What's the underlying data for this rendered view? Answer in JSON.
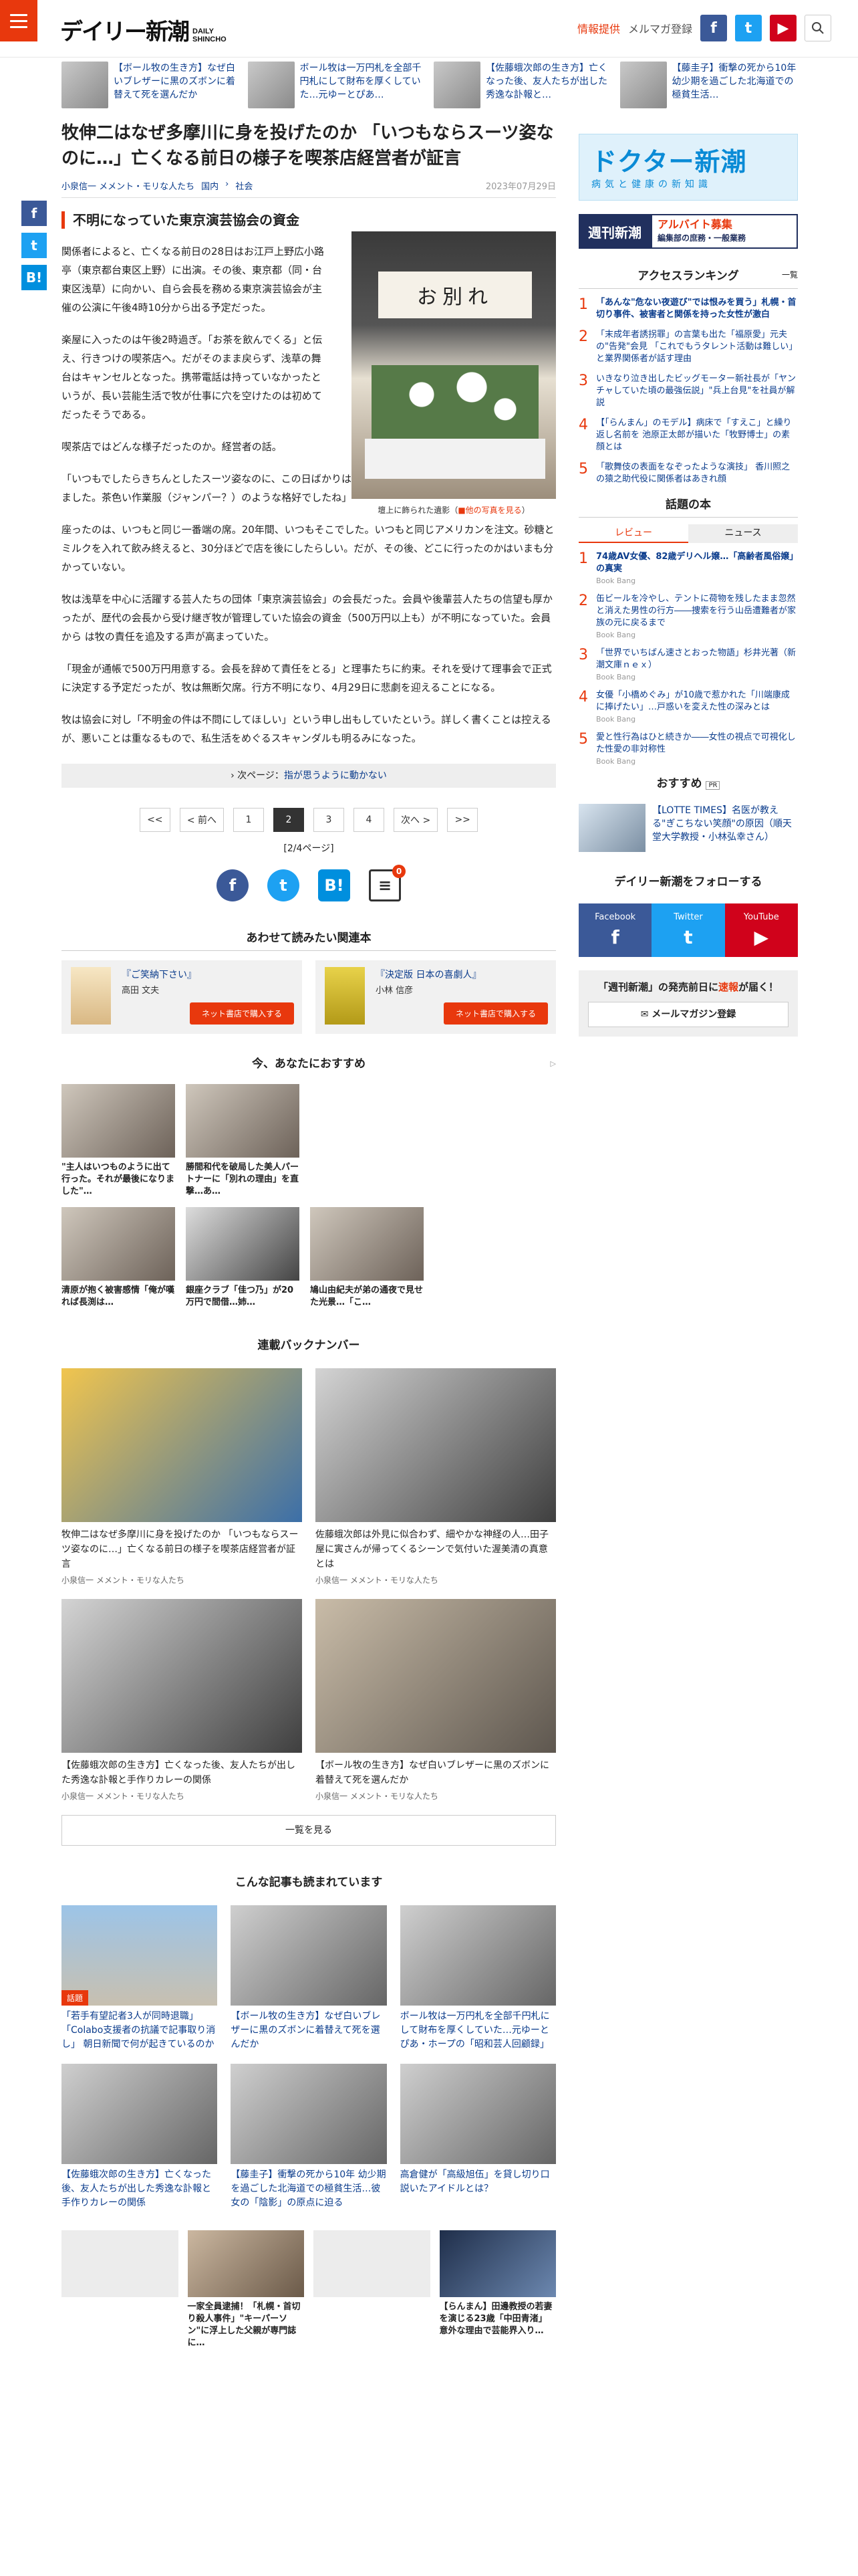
{
  "header": {
    "logo_jp": "デイリー新潮",
    "logo_en_1": "DAILY",
    "logo_en_2": "SHINCHO",
    "info_link": "情報提供",
    "mailmag_link": "メルマガ登録",
    "fb": "f",
    "tw": "t",
    "yt": "▶"
  },
  "strip": [
    {
      "text": "【ボール牧の生き方】なぜ白いブレザーに黒のズボンに着替えて死を選んだか"
    },
    {
      "text": "ボール牧は一万円札を全部千円札にして財布を厚くしていた…元ゆーとぴあ…"
    },
    {
      "text": "【佐藤蛾次郎の生き方】亡くなった後、友人たちが出した秀逸な訃報と…"
    },
    {
      "text": "【藤圭子】衝撃の死から10年 幼少期を過ごした北海道での極貧生活…"
    }
  ],
  "article": {
    "headline": "牧伸二はなぜ多摩川に身を投げたのか 「いつもならスーツ姿なのに…」亡くなる前日の様子を喫茶店経営者が証言",
    "author": "小泉信一 メメント・モリな人たち",
    "cat1": "国内",
    "cat2": "社会",
    "date": "2023年07月29日",
    "section": "不明になっていた東京演芸協会の資金",
    "p1": "関係者によると、亡くなる前日の28日はお江戸上野広小路亭（東京都台東区上野）に出演。その後、東京都（同・台東区浅草）に向かい、自ら会長を務める東京演芸協会が主催の公演に午後4時10分から出る予定だった。",
    "p2": "楽屋に入ったのは午後2時過ぎ。「お茶を飲んでくる」と伝え、行きつけの喫茶店へ。だがそのまま戻らず、浅草の舞台はキャンセルとなった。携帯電話は持っていなかったというが、長い芸能生活で牧が仕事に穴を空けたのは初めてだったそうである。",
    "p3": "喫茶店ではどんな様子だったのか。経営者の話。",
    "p4": "「いつもでしたらきちんとしたスーツ姿なのに、この日ばかりは浮かない顔つきで一人でコーヒーを飲んでいました。茶色い作業服（ジャンパー？）のような格好でしたね」",
    "p5": "座ったのは、いつもと同じ一番端の席。20年間、いつもそこでした。いつもと同じアメリカンを注文。砂糖とミルクを入れて飲み終えると、30分ほどで店を後にしたらしい。だが、その後、どこに行ったのかはいまも分かっていない。",
    "p6": "牧は浅草を中心に活躍する芸人たちの団体「東京演芸協会」の会長だった。会員や後輩芸人たちの信望も厚かったが、歴代の会長から受け継ぎ牧が管理していた協会の資金（500万円以上も）が不明になっていた。会員から は牧の責任を追及する声が高まっていた。",
    "p7": "「現金が通帳で500万円用意する。会長を辞めて責任をとる」と理事たちに約束。それを受けて理事会で正式に決定する予定だったが、牧は無断欠席。行方不明になり、4月29日に悲劇を迎えることになる。",
    "p8": "牧は協会に対し「不明金の件は不問にしてほしい」という申し出もしていたという。詳しく書くことは控えるが、悪いことは重なるもので、私生活をめぐるスキャンダルも明るみになった。",
    "photo_banner": "お別れ",
    "photo_caption": "壇上に飾られた遺影",
    "photo_caption_link": "他の写真を見る",
    "next_label": "次ページ：",
    "next_link": "指が思うように動かない",
    "pager": [
      "<<",
      "< 前へ",
      "1",
      "2",
      "3",
      "4",
      "次へ >",
      ">>"
    ],
    "page_count": "[2/4ページ]",
    "comment_count": "0"
  },
  "related": {
    "head": "あわせて読みたい関連本",
    "books": [
      {
        "title": "『ご笑納下さい』",
        "author": "高田 文夫",
        "buy": "ネット書店で購入する"
      },
      {
        "title": "『決定版 日本の喜劇人』",
        "author": "小林 信彦",
        "buy": "ネット書店で購入する"
      }
    ]
  },
  "recommend": {
    "head": "今、あなたにおすすめ",
    "items": [
      {
        "text": "\"主人はいつものように出て行った。それが最後になりました\"…"
      },
      {
        "text": "勝間和代を破局した美人パートナーに「別れの理由」を直撃…あ…"
      },
      {
        "text": ""
      },
      {
        "text": "清原が抱く被害感情「俺が嘆れば長渕は…"
      },
      {
        "text": "銀座クラブ「佳つ乃」が20万円で間借…姉…"
      },
      {
        "text": "鳩山由紀夫が弟の通夜で見せた光景…「こ…"
      }
    ]
  },
  "backnumbers": {
    "head": "連載バックナンバー",
    "items": [
      {
        "title": "牧伸二はなぜ多摩川に身を投げたのか 「いつもならスーツ姿なのに…」亡くなる前日の様子を喫茶店経営者が証言",
        "author": "小泉信一 メメント・モリな人たち"
      },
      {
        "title": "佐藤蛾次郎は外見に似合わず、細やかな神経の人…田子屋に寅さんが帰ってくるシーンで気付いた渥美清の真意とは",
        "author": "小泉信一 メメント・モリな人たち"
      },
      {
        "title": "【佐藤蛾次郎の生き方】亡くなった後、友人たちが出した秀逸な訃報と手作りカレーの関係",
        "author": "小泉信一 メメント・モリな人たち"
      },
      {
        "title": "【ボール牧の生き方】なぜ白いブレザーに黒のズボンに着替えて死を選んだか",
        "author": "小泉信一 メメント・モリな人たち"
      }
    ],
    "see_all": "一覧を見る"
  },
  "also_read": {
    "head": "こんな記事も読まれています",
    "items": [
      {
        "tag": "話題",
        "text": "「若手有望記者3人が同時退職」「Colabo支援者の抗議で記事取り消し」 朝日新聞で何が起きているのか"
      },
      {
        "tag": "",
        "text": "【ボール牧の生き方】なぜ白いブレザーに黒のズボンに着替えて死を選んだか"
      },
      {
        "tag": "",
        "text": "ボール牧は一万円札を全部千円札にして財布を厚くしていた…元ゆーとぴあ・ホープの「昭和芸人回顧録」"
      },
      {
        "tag": "",
        "text": "【佐藤蛾次郎の生き方】亡くなった後、友人たちが出した秀逸な訃報と手作りカレーの関係"
      },
      {
        "tag": "",
        "text": "【藤圭子】衝撃の死から10年 幼少期を過ごした北海道での極貧生活…彼女の「陰影」の原点に迫る"
      },
      {
        "tag": "",
        "text": "高倉健が「高級旭伍」を貸し切り口説いたアイドルとは？"
      }
    ]
  },
  "more_ads": [
    {
      "text": ""
    },
    {
      "text": "一家全員逮捕！「札幌・首切り殺人事件」\"キーパーソン\"に浮上した父親が専門誌に…"
    },
    {
      "text": ""
    },
    {
      "text": "【らんまん】田邊教授の若妻を演じる23歳「中田青渚」 意外な理由で芸能界入り…"
    }
  ],
  "sidebar": {
    "doctor_a": "ドクター新潮",
    "doctor_b": "病気と健康の新知識",
    "shukan_l": "週刊新潮",
    "shukan_r": "アルバイト募集",
    "shukan_r2": "編集部の庶務・一般業務",
    "ranking_head": "アクセスランキング",
    "ranking_sub": "一覧",
    "ranking": [
      {
        "n": "1",
        "t": "「あんな\"危ない夜遊び\"では恨みを買う」札幌・首切り事件、被害者と関係を持った女性が激白",
        "s": ""
      },
      {
        "n": "2",
        "t": "「末成年者誘拐罪」の言葉も出た「福原愛」元夫の\"告発\"会見 「これでもうタレント活動は難しい」と業界関係者が話す理由",
        "s": ""
      },
      {
        "n": "3",
        "t": "いきなり泣き出したビッグモーター新社長が「ヤンチャしていた頃の最強伝説」\"兵上台見\"を社員が解説",
        "s": ""
      },
      {
        "n": "4",
        "t": "【「らんまん」のモデル】病床で「すえこ」と繰り返し名前を 池原正太郎が描いた「牧野博士」の素顔とは",
        "s": ""
      },
      {
        "n": "5",
        "t": "「歌舞伎の表面をなぞったような演技」 香川照之の猿之助代役に関係者はあきれ顔",
        "s": ""
      }
    ],
    "book_head": "話題の本",
    "tab_review": "レビュー",
    "tab_news": "ニュース",
    "books": [
      {
        "n": "1",
        "t": "74歳AV女優、82歳デリヘル嬢…「高齢者風俗嬢」の真実",
        "s": "Book Bang"
      },
      {
        "n": "2",
        "t": "缶ビールを冷やし、テントに荷物を残したまま忽然と消えた男性の行方――捜索を行う山岳遭難者が家族の元に戻るまで",
        "s": "Book Bang"
      },
      {
        "n": "3",
        "t": "「世界でいちばん速さとおった物語」杉井光著（新潮文庫ｎｅｘ）",
        "s": "Book Bang"
      },
      {
        "n": "4",
        "t": "女優「小橋めぐみ」が10歳で惹かれた「川端康成に捧げたい」…戸惑いを変えた性の深みとは",
        "s": "Book Bang"
      },
      {
        "n": "5",
        "t": "愛と性行為はひと続きか――女性の視点で可視化した性愛の非対称性",
        "s": "Book Bang"
      }
    ],
    "osusume_head": "おすすめ",
    "osusume_pr": "PR",
    "osusume_text": "【LOTTE TIMES】名医が教える\"ぎこちない笑顔\"の原因（順天堂大学教授・小林弘幸さん）",
    "follow_head": "デイリー新潮をフォローする",
    "follow_fb": "Facebook",
    "follow_tw": "Twitter",
    "follow_yt": "YouTube",
    "mail_text_1": "「週刊新潮」の発売前日に",
    "mail_text_2": "速報",
    "mail_text_3": "が届く！",
    "mail_btn": "メールマガジン登録"
  }
}
